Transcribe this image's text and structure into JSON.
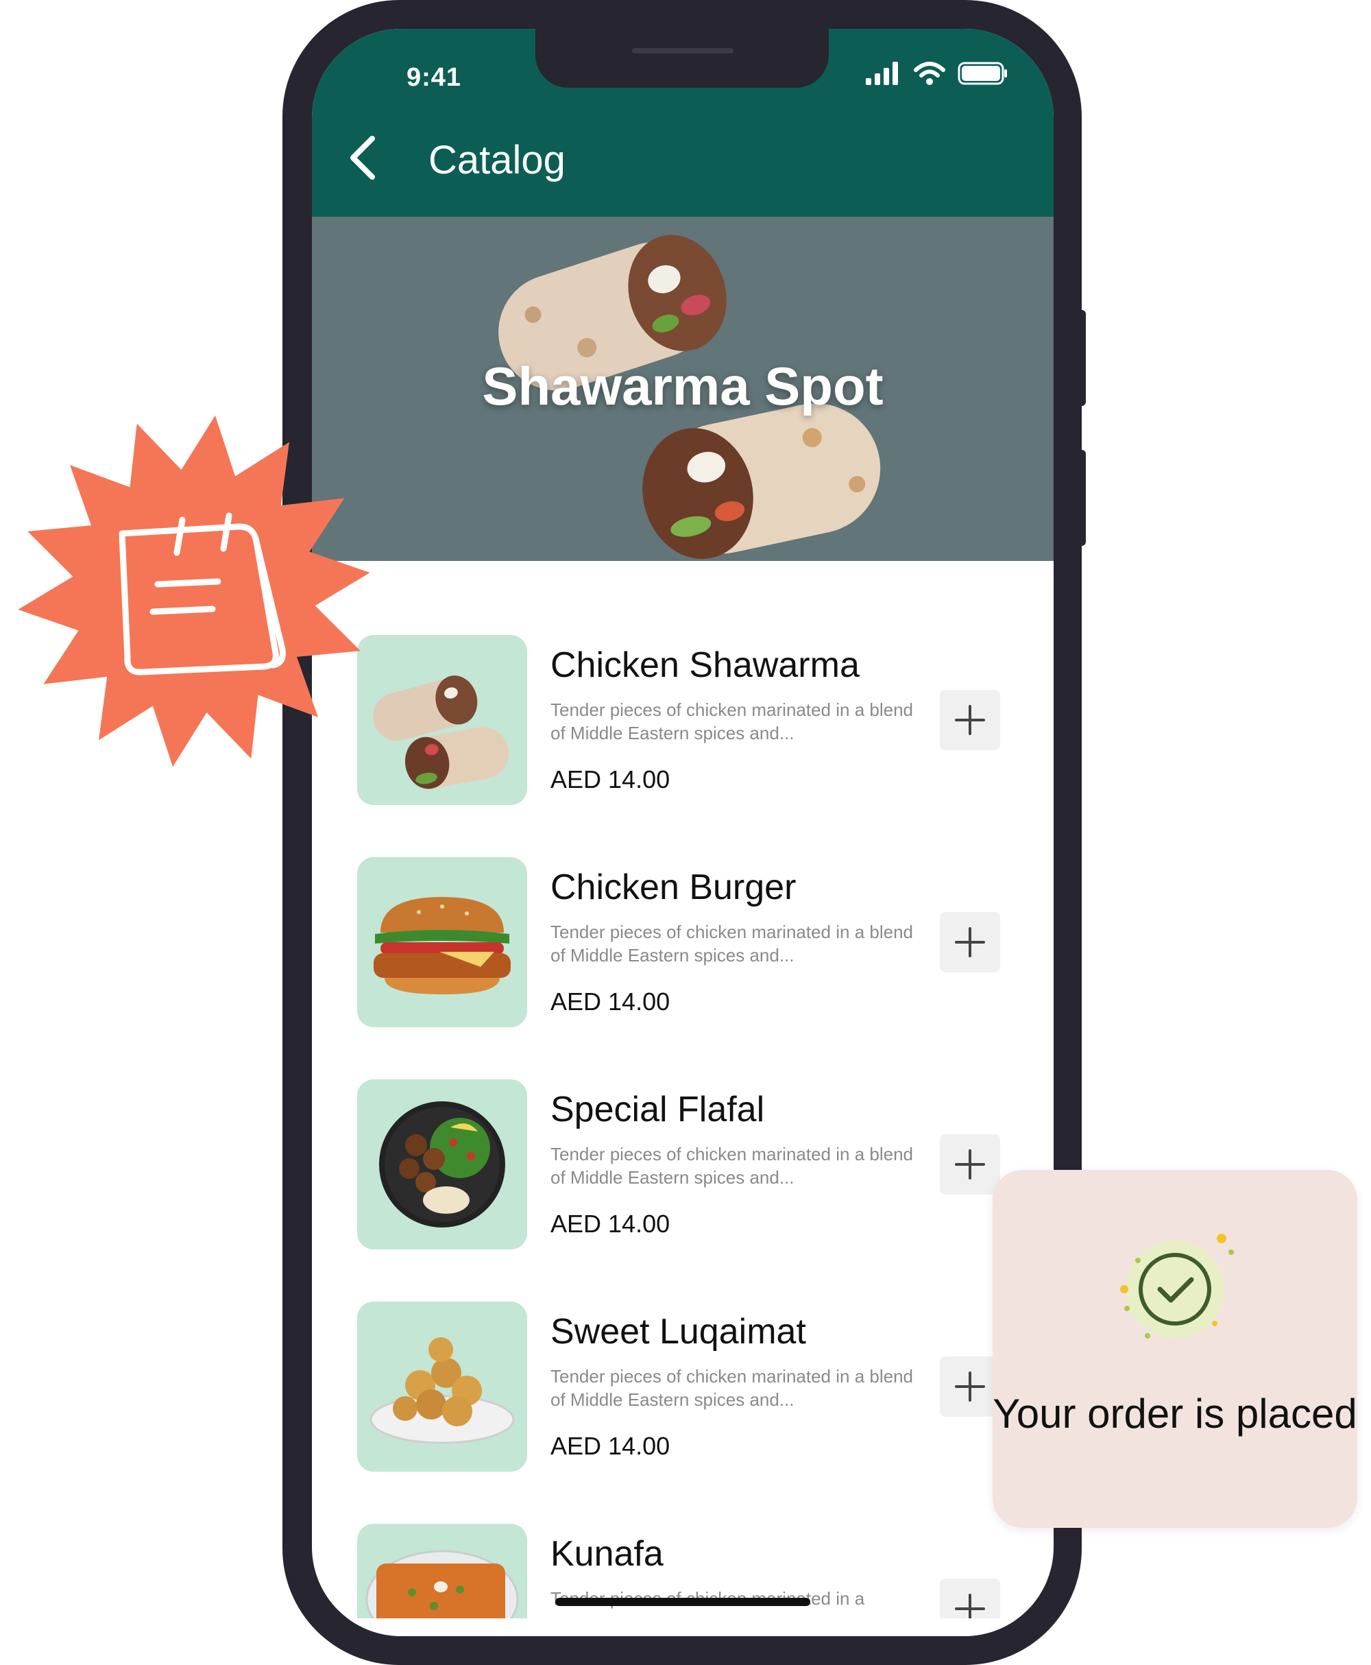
{
  "status_bar": {
    "time": "9:41"
  },
  "header": {
    "title": "Catalog"
  },
  "banner": {
    "title": "Shawarma Spot"
  },
  "menu_items": [
    {
      "name": "Chicken Shawarma",
      "description": "Tender pieces of chicken marinated in a blend of Middle Eastern spices and...",
      "price": "AED 14.00"
    },
    {
      "name": "Chicken Burger",
      "description": "Tender pieces of chicken marinated in a blend of Middle Eastern spices and...",
      "price": "AED 14.00"
    },
    {
      "name": "Special Flafal",
      "description": "Tender pieces of chicken marinated in a blend of Middle Eastern spices and...",
      "price": "AED 14.00"
    },
    {
      "name": "Sweet Luqaimat",
      "description": "Tender pieces of chicken marinated in a blend of Middle Eastern spices and...",
      "price": "AED 14.00"
    },
    {
      "name": "Kunafa",
      "description": "Tender pieces of chicken marinated in a",
      "price": ""
    }
  ],
  "toast": {
    "message": "Your order is placed"
  },
  "colors": {
    "header": "#0c5e55",
    "banner": "#627578",
    "thumb_bg": "#c3e6d5",
    "badge": "#f47656",
    "toast_bg": "#f3e3df"
  }
}
